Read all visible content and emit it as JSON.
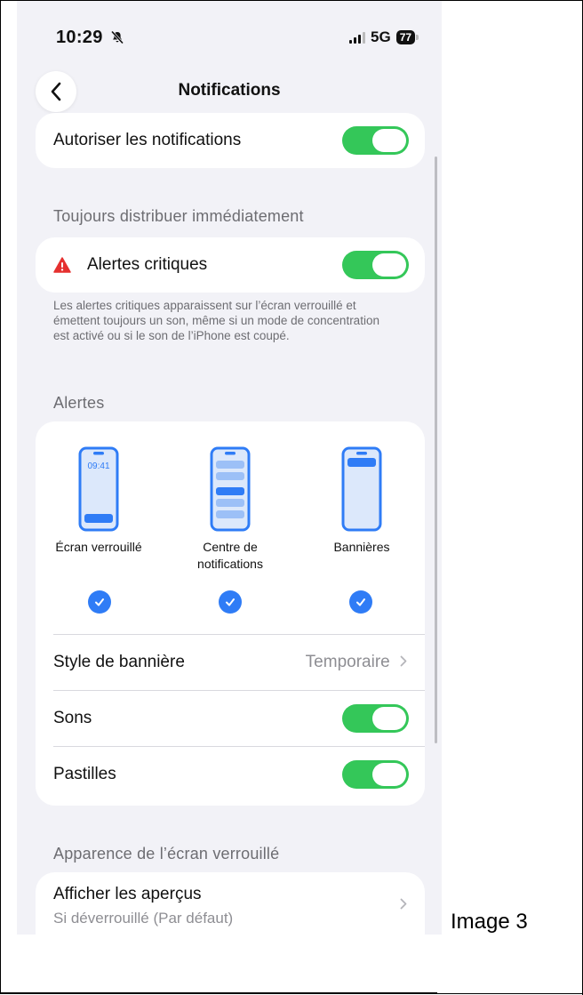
{
  "status": {
    "time": "10:29",
    "network": "5G",
    "battery": "77"
  },
  "nav": {
    "title": "Notifications"
  },
  "allow": {
    "label": "Autoriser les notifications"
  },
  "deliver_header": "Toujours distribuer immédiatement",
  "critical": {
    "label": "Alertes critiques",
    "note": "Les alertes critiques apparaissent sur l’écran verrouillé et émettent toujours un son, même si un mode de concentration est activé ou si le son de l’iPhone est coupé."
  },
  "alerts_header": "Alertes",
  "alert_styles": {
    "lock_time": "09:41",
    "lock": "Écran verrouillé",
    "center_line1": "Centre de",
    "center_line2": "notifications",
    "banners": "Bannières"
  },
  "banner_style": {
    "label": "Style de bannière",
    "value": "Temporaire"
  },
  "sounds": {
    "label": "Sons"
  },
  "badges": {
    "label": "Pastilles"
  },
  "lockscreen_header": "Apparence de l’écran verrouillé",
  "previews": {
    "label": "Afficher les aperçus",
    "value": "Si déverrouillé (Par défaut)"
  },
  "caption": "Image 3",
  "colors": {
    "toggle_on": "#34c759",
    "accent": "#2f7cf6",
    "critical": "#e5302f",
    "background": "#f2f2f7"
  }
}
